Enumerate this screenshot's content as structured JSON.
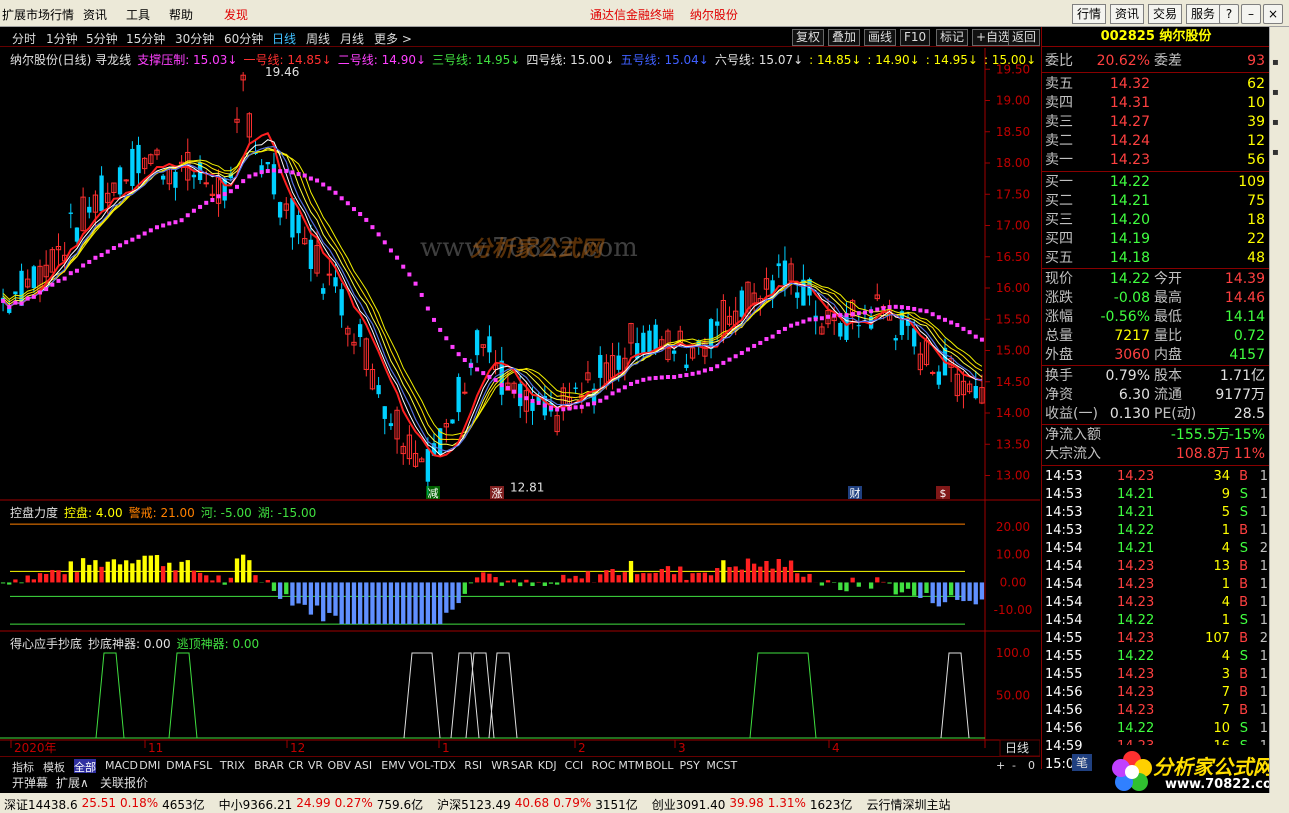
{
  "menu": {
    "items": [
      "扩展市场行情",
      "资讯",
      "工具",
      "帮助",
      "发现"
    ],
    "center1": "通达信金融终端",
    "center2": "纳尔股份",
    "right_buttons": [
      "行情",
      "资讯",
      "交易",
      "服务"
    ]
  },
  "periods": [
    "分时",
    "1分钟",
    "5分钟",
    "15分钟",
    "30分钟",
    "60分钟",
    "日线",
    "周线",
    "月线",
    "更多 >"
  ],
  "toolbar": [
    "复权",
    "叠加",
    "画线",
    "F10",
    "标记",
    "+自选",
    "返回"
  ],
  "legend": {
    "main": [
      {
        "text": "纳尔股份(日线) 寻龙线",
        "color": "#e0e0e0"
      },
      {
        "text": "支撑压制: 15.03↓",
        "color": "#ff40ff"
      },
      {
        "text": "一号线: 14.85↓",
        "color": "#ff3030"
      },
      {
        "text": "二号线: 14.90↓",
        "color": "#ff40ff"
      },
      {
        "text": "三号线: 14.95↓",
        "color": "#40e040"
      },
      {
        "text": "四号线: 15.00↓",
        "color": "#e0e0e0"
      },
      {
        "text": "五号线: 15.04↓",
        "color": "#4060ff"
      },
      {
        "text": "六号线: 15.07↓",
        "color": "#e0e0e0"
      },
      {
        "text": ": 14.85↓",
        "color": "#ffff00"
      },
      {
        "text": ": 14.90↓",
        "color": "#ffff00"
      },
      {
        "text": ": 14.95↓",
        "color": "#ffff00"
      },
      {
        "text": ": 15.00↓",
        "color": "#ffff00"
      }
    ],
    "sub1": [
      {
        "text": "控盘力度",
        "color": "#e0e0e0"
      },
      {
        "text": "控盘: 4.00",
        "color": "#ffff00"
      },
      {
        "text": "警戒: 21.00",
        "color": "#ff8000"
      },
      {
        "text": "河: -5.00",
        "color": "#40e040"
      },
      {
        "text": "湖: -15.00",
        "color": "#40e040"
      }
    ],
    "sub2": [
      {
        "text": "得心应手抄底",
        "color": "#e0e0e0"
      },
      {
        "text": "抄底神器: 0.00",
        "color": "#e0e0e0"
      },
      {
        "text": "逃顶神器: 0.00",
        "color": "#40e040"
      }
    ]
  },
  "chart_data": {
    "type": "candlestick",
    "y_ticks": [
      "19.50",
      "19.00",
      "18.50",
      "18.00",
      "17.50",
      "17.00",
      "16.50",
      "16.00",
      "15.50",
      "15.00",
      "14.50",
      "14.00",
      "13.50",
      "13.00"
    ],
    "ylim": [
      12.8,
      19.6
    ],
    "high_label": "19.46",
    "low_label": "12.81",
    "sub1_ticks": [
      "20.00",
      "10.00",
      "0.00",
      "-10.00"
    ],
    "sub2_ticks": [
      "100.0",
      "50.00"
    ],
    "x_labels": [
      "2020年",
      "11",
      "12",
      "1",
      "2",
      "3",
      "4"
    ],
    "markers": [
      "减",
      "涨",
      "财",
      "$"
    ]
  },
  "quote": {
    "code_name": "002825 纳尔股份",
    "weibi_label": "委比",
    "weibi": "20.62%",
    "weicha_label": "委差",
    "weicha": "93",
    "sell": [
      {
        "l": "卖五",
        "p": "14.32",
        "v": "62"
      },
      {
        "l": "卖四",
        "p": "14.31",
        "v": "10"
      },
      {
        "l": "卖三",
        "p": "14.27",
        "v": "39"
      },
      {
        "l": "卖二",
        "p": "14.24",
        "v": "12"
      },
      {
        "l": "卖一",
        "p": "14.23",
        "v": "56"
      }
    ],
    "buy": [
      {
        "l": "买一",
        "p": "14.22",
        "v": "109"
      },
      {
        "l": "买二",
        "p": "14.21",
        "v": "75"
      },
      {
        "l": "买三",
        "p": "14.20",
        "v": "18"
      },
      {
        "l": "买四",
        "p": "14.19",
        "v": "22"
      },
      {
        "l": "买五",
        "p": "14.18",
        "v": "48"
      }
    ],
    "stats": [
      {
        "l1": "现价",
        "v1": "14.22",
        "c1": "#40ff40",
        "l2": "今开",
        "v2": "14.39",
        "c2": "#ff4040"
      },
      {
        "l1": "涨跌",
        "v1": "-0.08",
        "c1": "#40ff40",
        "l2": "最高",
        "v2": "14.46",
        "c2": "#ff4040"
      },
      {
        "l1": "涨幅",
        "v1": "-0.56%",
        "c1": "#40ff40",
        "l2": "最低",
        "v2": "14.14",
        "c2": "#40ff40"
      },
      {
        "l1": "总量",
        "v1": "7217",
        "c1": "#ffff00",
        "l2": "量比",
        "v2": "0.72",
        "c2": "#40ff40"
      },
      {
        "l1": "外盘",
        "v1": "3060",
        "c1": "#ff4040",
        "l2": "内盘",
        "v2": "4157",
        "c2": "#40ff40"
      }
    ],
    "stats2": [
      {
        "l1": "换手",
        "v1": "0.79%",
        "c1": "#e0e0e0",
        "l2": "股本",
        "v2": "1.71亿",
        "c2": "#e0e0e0"
      },
      {
        "l1": "净资",
        "v1": "6.30",
        "c1": "#e0e0e0",
        "l2": "流通",
        "v2": "9177万",
        "c2": "#e0e0e0"
      },
      {
        "l1": "收益(一)",
        "v1": "0.130",
        "c1": "#e0e0e0",
        "l2": "PE(动)",
        "v2": "28.5",
        "c2": "#e0e0e0"
      }
    ],
    "flow": [
      {
        "l": "净流入额",
        "v": "-155.5万",
        "p": "-15%",
        "c": "#40ff40"
      },
      {
        "l": "大宗流入",
        "v": "108.8万",
        "p": "11%",
        "c": "#ff4040"
      }
    ],
    "ticks": [
      {
        "t": "14:53",
        "p": "14.23",
        "v": "34",
        "bs": "B",
        "n": "1"
      },
      {
        "t": "14:53",
        "p": "14.21",
        "v": "9",
        "bs": "S",
        "n": "1"
      },
      {
        "t": "14:53",
        "p": "14.21",
        "v": "5",
        "bs": "S",
        "n": "1"
      },
      {
        "t": "14:53",
        "p": "14.22",
        "v": "1",
        "bs": "B",
        "n": "1"
      },
      {
        "t": "14:54",
        "p": "14.21",
        "v": "4",
        "bs": "S",
        "n": "2"
      },
      {
        "t": "14:54",
        "p": "14.23",
        "v": "13",
        "bs": "B",
        "n": "1"
      },
      {
        "t": "14:54",
        "p": "14.23",
        "v": "1",
        "bs": "B",
        "n": "1"
      },
      {
        "t": "14:54",
        "p": "14.23",
        "v": "4",
        "bs": "B",
        "n": "1"
      },
      {
        "t": "14:54",
        "p": "14.22",
        "v": "1",
        "bs": "S",
        "n": "1"
      },
      {
        "t": "14:55",
        "p": "14.23",
        "v": "107",
        "bs": "B",
        "n": "2"
      },
      {
        "t": "14:55",
        "p": "14.22",
        "v": "4",
        "bs": "S",
        "n": "1"
      },
      {
        "t": "14:55",
        "p": "14.23",
        "v": "3",
        "bs": "B",
        "n": "1"
      },
      {
        "t": "14:56",
        "p": "14.23",
        "v": "7",
        "bs": "B",
        "n": "1"
      },
      {
        "t": "14:56",
        "p": "14.23",
        "v": "7",
        "bs": "B",
        "n": "1"
      },
      {
        "t": "14:56",
        "p": "14.22",
        "v": "10",
        "bs": "S",
        "n": "1"
      },
      {
        "t": "14:59",
        "p": "14.23",
        "v": "16",
        "bs": "S",
        "n": "1"
      },
      {
        "t": "15:00",
        "p": "",
        "v": "",
        "bs": "",
        "n": ""
      }
    ]
  },
  "indicator_tabs": [
    "指标",
    "模板",
    "全部",
    "MACD",
    "DMI",
    "DMA",
    "FSL",
    "TRIX",
    "BRAR",
    "CR",
    "VR",
    "OBV",
    "ASI",
    "EMV",
    "VOL-TDX",
    "RSI",
    "WR",
    "SAR",
    "KDJ",
    "CCI",
    "ROC",
    "MTM",
    "BOLL",
    "PSY",
    "MCST"
  ],
  "bottom_tabs": [
    "开弹幕",
    "扩展∧",
    "关联报价"
  ],
  "period_label": "日线",
  "status": [
    {
      "t": "深证14438.6",
      "c": "#000"
    },
    {
      "t": "25.51",
      "c": "#e00000"
    },
    {
      "t": "0.18%",
      "c": "#e00000"
    },
    {
      "t": "4653亿",
      "c": "#000"
    },
    {
      "t": "中小9366.21",
      "c": "#000"
    },
    {
      "t": "24.99",
      "c": "#e00000"
    },
    {
      "t": "0.27%",
      "c": "#e00000"
    },
    {
      "t": "759.6亿",
      "c": "#000"
    },
    {
      "t": "沪深5123.49",
      "c": "#000"
    },
    {
      "t": "40.68",
      "c": "#e00000"
    },
    {
      "t": "0.79%",
      "c": "#e00000"
    },
    {
      "t": "3151亿",
      "c": "#000"
    },
    {
      "t": "创业3091.40",
      "c": "#000"
    },
    {
      "t": "39.98",
      "c": "#e00000"
    },
    {
      "t": "1.31%",
      "c": "#e00000"
    },
    {
      "t": "1623亿",
      "c": "#000"
    },
    {
      "t": "云行情深圳主站",
      "c": "#000"
    }
  ],
  "stroke_btn": "笔",
  "watermark": "www.70822.com",
  "logo": {
    "l1": "分析家公式网",
    "l2": "www.70822.com"
  }
}
